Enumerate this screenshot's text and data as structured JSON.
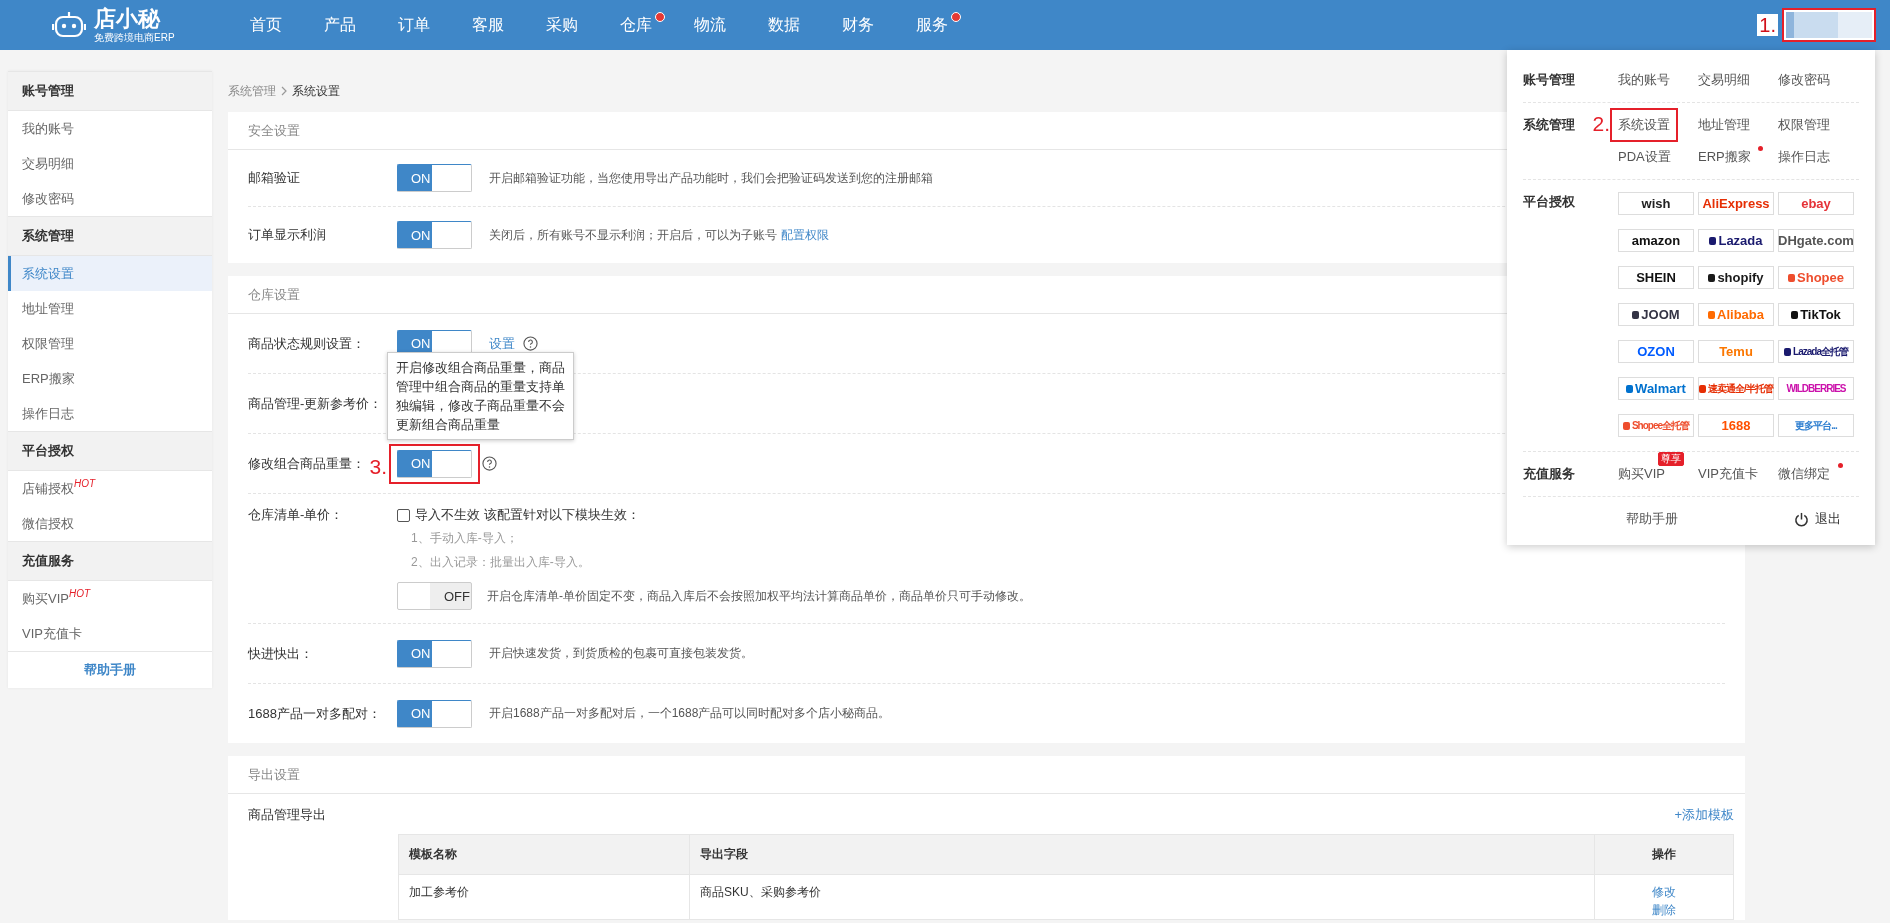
{
  "header": {
    "logo": "店小秘",
    "tagline": "免费跨境电商ERP",
    "nav": [
      {
        "label": "首页",
        "dot": false
      },
      {
        "label": "产品",
        "dot": false
      },
      {
        "label": "订单",
        "dot": false
      },
      {
        "label": "客服",
        "dot": false
      },
      {
        "label": "采购",
        "dot": false
      },
      {
        "label": "仓库",
        "dot": true
      },
      {
        "label": "物流",
        "dot": false
      },
      {
        "label": "数据",
        "dot": false
      },
      {
        "label": "财务",
        "dot": false
      },
      {
        "label": "服务",
        "dot": true
      }
    ],
    "account": {
      "annotation": "1."
    }
  },
  "sidebar": {
    "groups": [
      {
        "title": "账号管理",
        "items": [
          {
            "label": "我的账号",
            "selected": false
          },
          {
            "label": "交易明细",
            "selected": false
          },
          {
            "label": "修改密码",
            "selected": false
          }
        ]
      },
      {
        "title": "系统管理",
        "items": [
          {
            "label": "系统设置",
            "selected": true
          },
          {
            "label": "地址管理",
            "selected": false
          },
          {
            "label": "权限管理",
            "selected": false
          },
          {
            "label": "ERP搬家",
            "selected": false
          },
          {
            "label": "操作日志",
            "selected": false
          }
        ]
      },
      {
        "title": "平台授权",
        "items": [
          {
            "label": "店铺授权",
            "badge": "HOT",
            "selected": false
          },
          {
            "label": "微信授权",
            "selected": false
          }
        ]
      },
      {
        "title": "充值服务",
        "items": [
          {
            "label": "购买VIP",
            "badge": "HOT",
            "selected": false
          },
          {
            "label": "VIP充值卡",
            "selected": false
          }
        ]
      }
    ],
    "help": "帮助手册"
  },
  "breadcrumb": {
    "parent": "系统管理",
    "current": "系统设置"
  },
  "sections": [
    {
      "title": "安全设置",
      "rows": [
        {
          "kind": "toggle",
          "label": "邮箱验证",
          "on": true,
          "toggle_text": "ON",
          "help": false,
          "desc": "开启邮箱验证功能，当您使用导出产品功能时，我们会把验证码发送到您的注册邮箱"
        },
        {
          "kind": "toggle",
          "label": "订单显示利润",
          "on": true,
          "toggle_text": "ON",
          "help": false,
          "desc": "关闭后，所有账号不显示利润；开启后，可以为子账号",
          "link": "配置权限"
        }
      ]
    },
    {
      "title": "仓库设置",
      "rows": [
        {
          "kind": "toggle",
          "label": "商品状态规则设置：",
          "on": true,
          "toggle_text": "ON",
          "help": true,
          "link": "设置"
        },
        {
          "kind": "label",
          "label": "商品管理-更新参考价："
        },
        {
          "kind": "toggle",
          "label": "修改组合商品重量：",
          "on": true,
          "toggle_text": "ON",
          "help": true,
          "annotation": "3.",
          "tooltip": "开启修改组合商品重量，商品管理中组合商品的重量支持单独编辑，修改子商品重量不会更新组合商品重量"
        },
        {
          "kind": "checkbox",
          "label": "仓库清单-单价：",
          "checked": false,
          "check_label": "导入不生效 该配置针对以下模块生效：",
          "notes": [
            "1、手动入库-导入；",
            "2、出入记录：批量出入库-导入。"
          ],
          "on": false,
          "toggle_text": "OFF",
          "desc": "开启仓库清单-单价固定不变，商品入库后不会按照加权平均法计算商品单价，商品单价只可手动修改。"
        },
        {
          "kind": "toggle",
          "label": "快进快出：",
          "on": true,
          "toggle_text": "ON",
          "help": false,
          "desc": "开启快速发货，到货质检的包裹可直接包装发货。"
        },
        {
          "kind": "toggle",
          "label": "1688产品一对多配对：",
          "on": true,
          "toggle_text": "ON",
          "help": false,
          "desc": "开启1688产品一对多配对后，一个1688产品可以同时配对多个店小秘商品。"
        }
      ]
    }
  ],
  "export": {
    "title": "导出设置",
    "label": "商品管理导出",
    "add": "+添加模板",
    "columns": [
      "模板名称",
      "导出字段",
      "操作"
    ],
    "rows": [
      {
        "name": "加工参考价",
        "fields": "商品SKU、采购参考价",
        "actions": [
          "修改",
          "删除"
        ]
      }
    ]
  },
  "account_menu": {
    "sections": [
      {
        "title": "账号管理",
        "items": [
          {
            "label": "我的账号",
            "dot": false
          },
          {
            "label": "交易明细",
            "dot": false
          },
          {
            "label": "修改密码",
            "dot": false
          }
        ]
      },
      {
        "title": "系统管理",
        "items": [
          {
            "label": "系统设置",
            "dot": false,
            "annotation": "2."
          },
          {
            "label": "地址管理",
            "dot": false
          },
          {
            "label": "权限管理",
            "dot": false
          },
          {
            "label": "PDA设置",
            "dot": false
          },
          {
            "label": "ERP搬家",
            "dot": true
          },
          {
            "label": "操作日志",
            "dot": false
          }
        ]
      },
      {
        "title": "平台授权",
        "platforms": [
          {
            "label": "wish",
            "kind": "wordmark",
            "color": "#222222",
            "icon": false
          },
          {
            "label": "AliExpress",
            "kind": "wordmark",
            "color": "#e62e04",
            "icon": false
          },
          {
            "label": "ebay",
            "kind": "wordmark",
            "color": "#e53238",
            "icon": false
          },
          {
            "label": "amazon",
            "kind": "wordmark",
            "color": "#111111",
            "icon": false
          },
          {
            "label": "Lazada",
            "kind": "wordmark",
            "color": "#1a1a6e",
            "icon": true
          },
          {
            "label": "DHgate.com",
            "kind": "wordmark",
            "color": "#555555",
            "icon": false
          },
          {
            "label": "SHEIN",
            "kind": "wordmark",
            "color": "#111111",
            "icon": false
          },
          {
            "label": "shopify",
            "kind": "wordmark",
            "color": "#1a1a1a",
            "icon": true
          },
          {
            "label": "Shopee",
            "kind": "wordmark",
            "color": "#ee4d2d",
            "icon": true
          },
          {
            "label": "JOOM",
            "kind": "wordmark",
            "color": "#333344",
            "icon": true
          },
          {
            "label": "Alibaba",
            "kind": "wordmark",
            "color": "#ff6a00",
            "icon": true
          },
          {
            "label": "TikTok",
            "kind": "wordmark",
            "color": "#111111",
            "icon": true
          },
          {
            "label": "OZON",
            "kind": "wordmark",
            "color": "#005bff",
            "icon": false
          },
          {
            "label": "Temu",
            "kind": "wordmark",
            "color": "#fb7701",
            "icon": false
          },
          {
            "label": "Lazada全托管",
            "kind": "caption",
            "color": "#1a1a6e",
            "icon": true
          },
          {
            "label": "Walmart",
            "kind": "wordmark",
            "color": "#0071ce",
            "icon": true
          },
          {
            "label": "速卖通全/半托管",
            "kind": "caption",
            "color": "#e62e04",
            "icon": true
          },
          {
            "label": "WILDBERRIES",
            "kind": "caption",
            "color": "#cb11ab",
            "icon": false
          },
          {
            "label": "Shopee全托管",
            "kind": "caption",
            "color": "#ee4d2d",
            "icon": true
          },
          {
            "label": "1688",
            "kind": "wordmark",
            "color": "#ff5000",
            "icon": false
          },
          {
            "label": "更多平台...",
            "kind": "caption",
            "color": "#2f7fd0",
            "icon": false
          }
        ]
      },
      {
        "title": "充值服务",
        "items": [
          {
            "label": "购买VIP",
            "dot": false,
            "badge": "尊享"
          },
          {
            "label": "VIP充值卡",
            "dot": false
          },
          {
            "label": "微信绑定",
            "dot": true
          }
        ]
      }
    ],
    "help": "帮助手册",
    "logout": "退出"
  }
}
